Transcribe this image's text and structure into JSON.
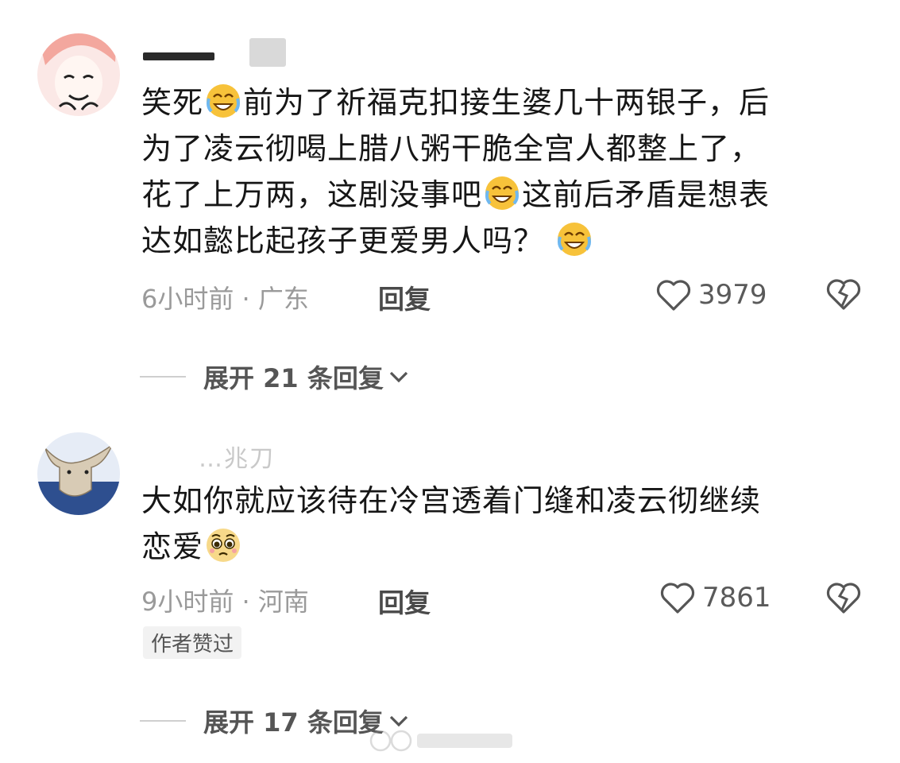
{
  "comments": [
    {
      "text_lines": [
        [
          "笑死",
          "emoji",
          "前为了祈福克扣接生婆几十两银子，后"
        ],
        [
          "为了凌云彻喝上腊八粥干脆全宫人都整上了，"
        ],
        [
          "花了上万两，这剧没事吧",
          "emoji",
          "这前后矛盾是想表"
        ],
        [
          "达如懿比起孩子更爱男人吗？ ",
          "emoji"
        ]
      ],
      "time": "6小时前",
      "location": "广东",
      "meta_sep": " · ",
      "reply_label": "回复",
      "likes": "3979",
      "expand_label": "展开 21 条回复"
    },
    {
      "author_partial": "…兆刀",
      "text_lines": [
        [
          "大如你就应该待在冷宫透着门缝和凌云彻继续"
        ],
        [
          "恋爱",
          "emoji2"
        ]
      ],
      "time": "9小时前",
      "location": "河南",
      "meta_sep": " · ",
      "reply_label": "回复",
      "likes": "7861",
      "author_liked": "作者赞过",
      "expand_label": "展开 17 条回复"
    }
  ],
  "icons": {
    "like": "heart-outline-icon",
    "dislike": "broken-heart-icon",
    "expand": "chevron-down-icon",
    "emoji_1": "laughing-crying-emoji",
    "emoji_2": "pleading-emoji"
  },
  "colors": {
    "text": "#161616",
    "meta": "#9a9a9a",
    "emoji_face": "#f7c23a"
  }
}
